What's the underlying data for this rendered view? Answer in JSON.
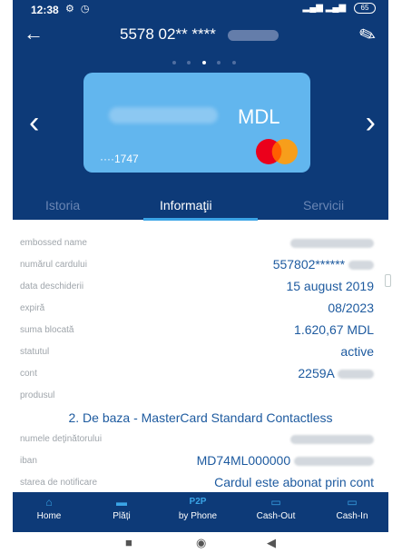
{
  "status": {
    "time": "12:38",
    "left_icons": "⚙ ◷",
    "signal": "▂▄▆ ▂▄▆",
    "battery": "65"
  },
  "header": {
    "title": "5578 02** ****"
  },
  "card": {
    "currency": "MDL",
    "number": "····1747"
  },
  "tabs": [
    {
      "label": "Istoria"
    },
    {
      "label": "Informaţii"
    },
    {
      "label": "Servicii"
    }
  ],
  "info": {
    "embossed_label": "embossed name",
    "card_number_label": "numărul cardului",
    "card_number_value": "557802******",
    "open_date_label": "data deschiderii",
    "open_date_value": "15 august 2019",
    "expiry_label": "expiră",
    "expiry_value": "08/2023",
    "blocked_label": "suma blocată",
    "blocked_value": "1.620,67 MDL",
    "status_label": "statutul",
    "status_value": "active",
    "account_label": "cont",
    "account_value": "2259A",
    "product_label": "produsul",
    "product_value": "2. De baza - MasterCard Standard Contactless",
    "holders_label": "numele deţinătorului",
    "iban_label": "iban",
    "iban_value": "MD74ML000000",
    "notify_label": "starea de notificare",
    "notify_value": "Cardul este abonat prin cont"
  },
  "bottom_nav": [
    {
      "label": "Home",
      "icon": "home-icon"
    },
    {
      "label": "Plăți",
      "icon": "wallet-icon"
    },
    {
      "top": "P2P",
      "label": "by Phone"
    },
    {
      "label": "Cash-Out",
      "icon": "atm-icon"
    },
    {
      "label": "Cash-In",
      "icon": "atm-icon"
    }
  ],
  "colors": {
    "header": "#0d3a78",
    "accent": "#3aa4e6",
    "card": "#62b6ee",
    "value_text": "#1d5a9f"
  }
}
